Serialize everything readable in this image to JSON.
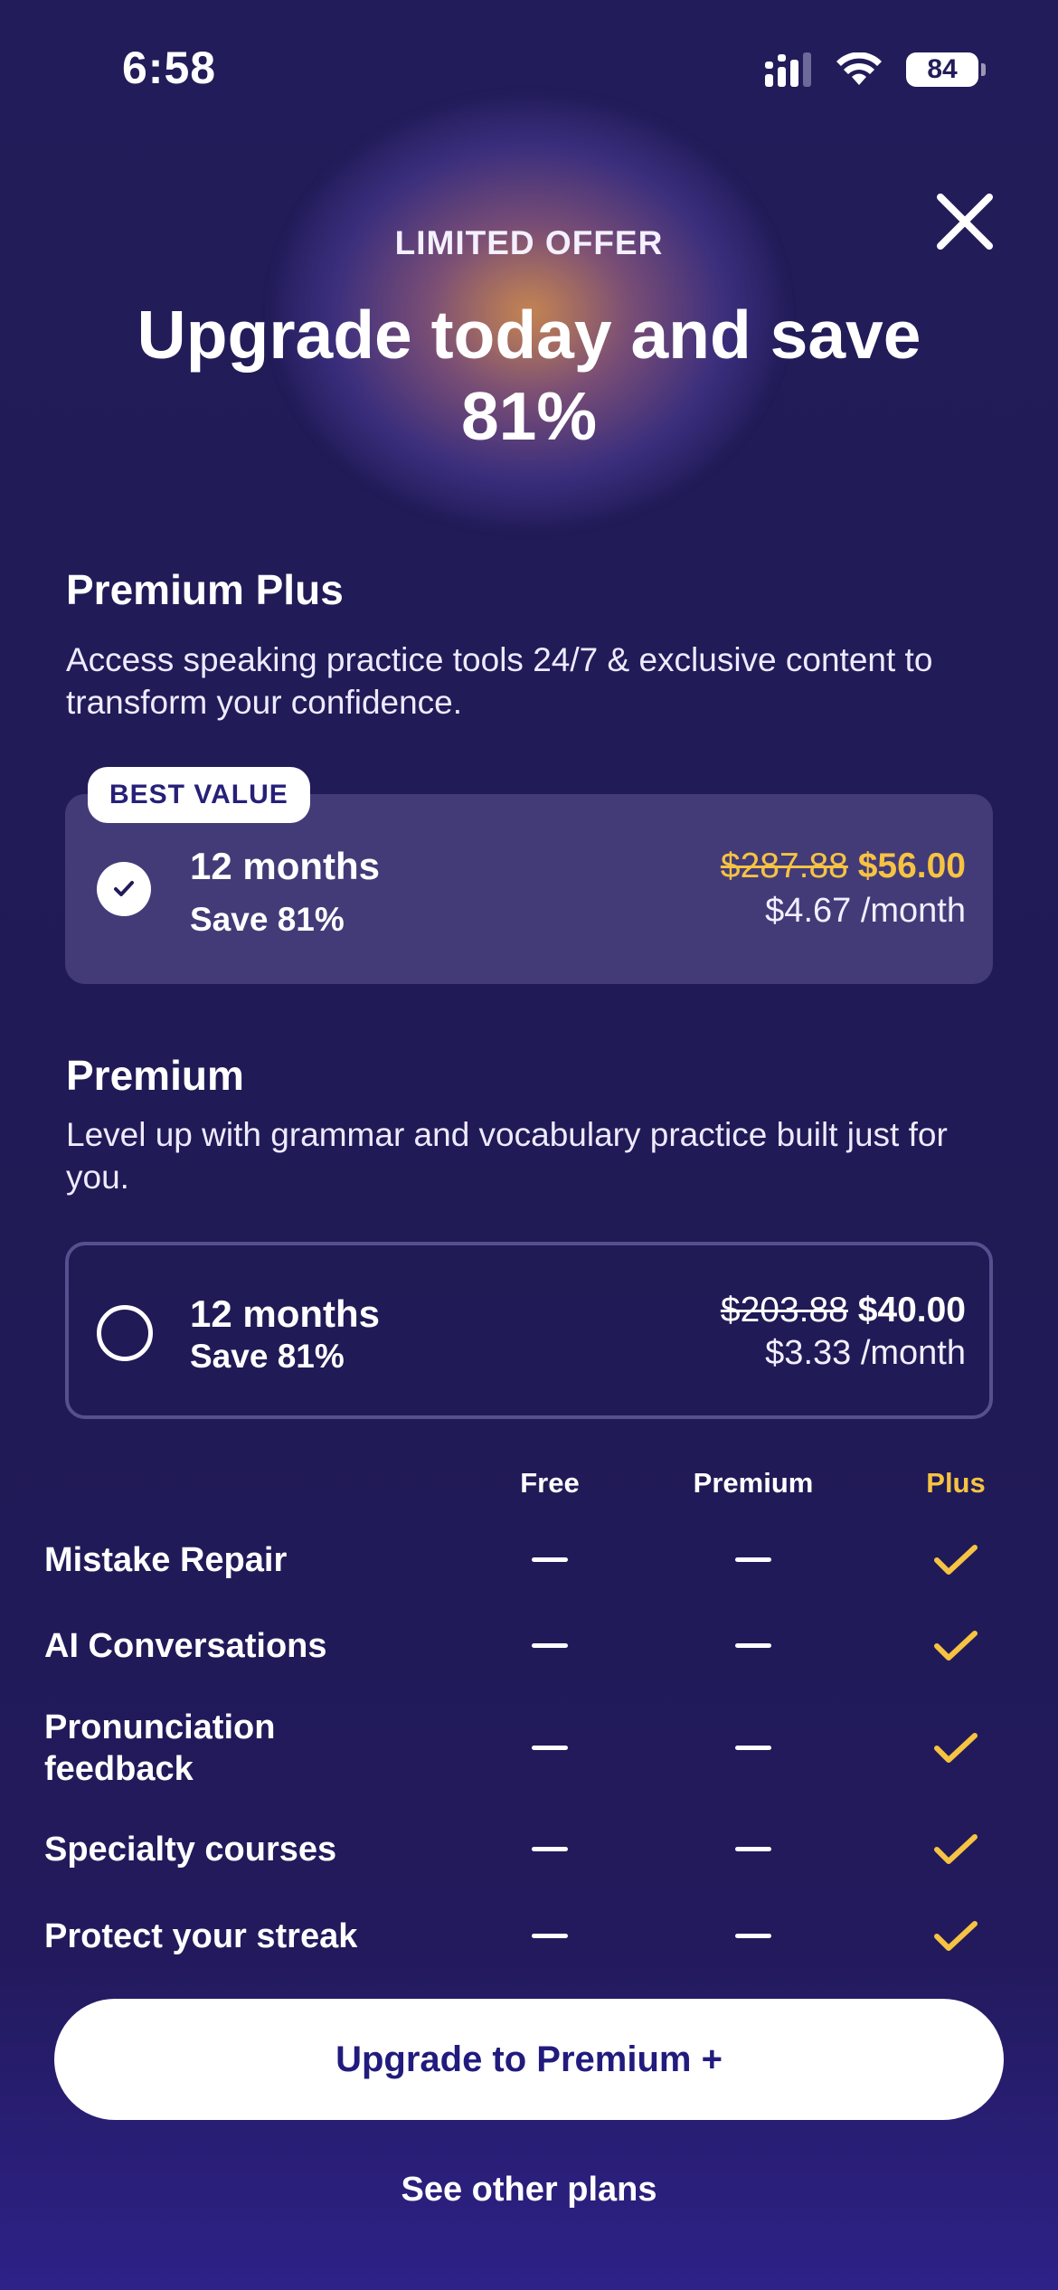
{
  "status_bar": {
    "time": "6:58",
    "battery": "84"
  },
  "header": {
    "offer_label": "LIMITED OFFER",
    "headline": "Upgrade today and save 81%",
    "close_icon": "close-icon"
  },
  "plans": [
    {
      "title": "Premium Plus",
      "description": "Access speaking practice tools 24/7 & exclusive content to transform your confidence.",
      "badge": "BEST VALUE",
      "selected": true,
      "duration": "12 months",
      "save": "Save 81%",
      "old_price": "$287.88",
      "new_price": "$56.00",
      "per_month": "$4.67 /month",
      "accent": "#f6c342"
    },
    {
      "title": "Premium",
      "description": "Level up with grammar and vocabulary practice built just for you.",
      "selected": false,
      "duration": "12 months",
      "save": "Save 81%",
      "old_price": "$203.88",
      "new_price": "$40.00",
      "per_month": "$3.33 /month"
    }
  ],
  "comparison": {
    "columns": [
      "Free",
      "Premium",
      "Plus"
    ],
    "rows": [
      {
        "feature": "Mistake Repair",
        "values": [
          "none",
          "none",
          "check"
        ]
      },
      {
        "feature": "AI Conversations",
        "values": [
          "none",
          "none",
          "check"
        ]
      },
      {
        "feature": "Pronunciation feedback",
        "values": [
          "none",
          "none",
          "check"
        ]
      },
      {
        "feature": "Specialty courses",
        "values": [
          "none",
          "none",
          "check"
        ]
      },
      {
        "feature": "Protect your streak",
        "values": [
          "none",
          "none",
          "check"
        ]
      }
    ]
  },
  "actions": {
    "cta": "Upgrade to Premium +",
    "secondary": "See other plans"
  },
  "colors": {
    "background": "#221c5a",
    "accent": "#f6c342",
    "cta_text": "#221b7e"
  }
}
